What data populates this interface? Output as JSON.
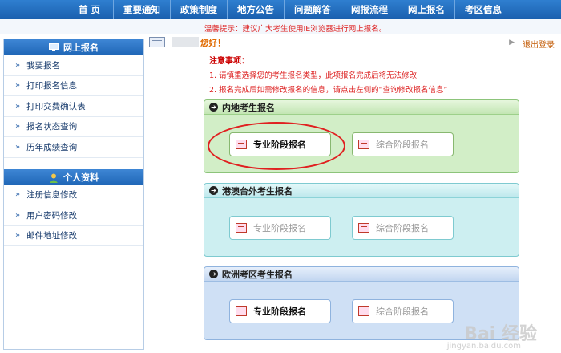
{
  "nav": {
    "items": [
      "首 页",
      "重要通知",
      "政策制度",
      "地方公告",
      "问题解答",
      "网报流程",
      "网上报名",
      "考区信息"
    ]
  },
  "tip": "温馨提示：建议广大考生使用IE浏览器进行网上报名。",
  "sidebar": {
    "section1_title": "网上报名",
    "section1_items": [
      "我要报名",
      "打印报名信息",
      "打印交费确认表",
      "报名状态查询",
      "历年成绩查询"
    ],
    "section2_title": "个人资料",
    "section2_items": [
      "注册信息修改",
      "用户密码修改",
      "邮件地址修改"
    ]
  },
  "header": {
    "hello": "您好！",
    "logout": "退出登录"
  },
  "notice": {
    "title": "注意事项：",
    "line1": "1. 请慎重选择您的考生报名类型，此项报名完成后将无法修改",
    "line2": "2. 报名完成后如需修改报名的信息，请点击左侧的“查询修改报名信息”"
  },
  "panels": [
    {
      "title": "内地考生报名",
      "left_button": "专业阶段报名",
      "right_button": "综合阶段报名"
    },
    {
      "title": "港澳台外考生报名",
      "left_button": "专业阶段报名",
      "right_button": "综合阶段报名"
    },
    {
      "title": "欧洲考区考生报名",
      "left_button": "专业阶段报名",
      "right_button": "综合阶段报名"
    }
  ],
  "watermark": {
    "main": "Bai 经验",
    "sub": "jingyan.baidu.com"
  },
  "colors": {
    "nav": "#1f66b6",
    "tip_red": "#dd2222",
    "highlight_circle": "#e02020"
  }
}
